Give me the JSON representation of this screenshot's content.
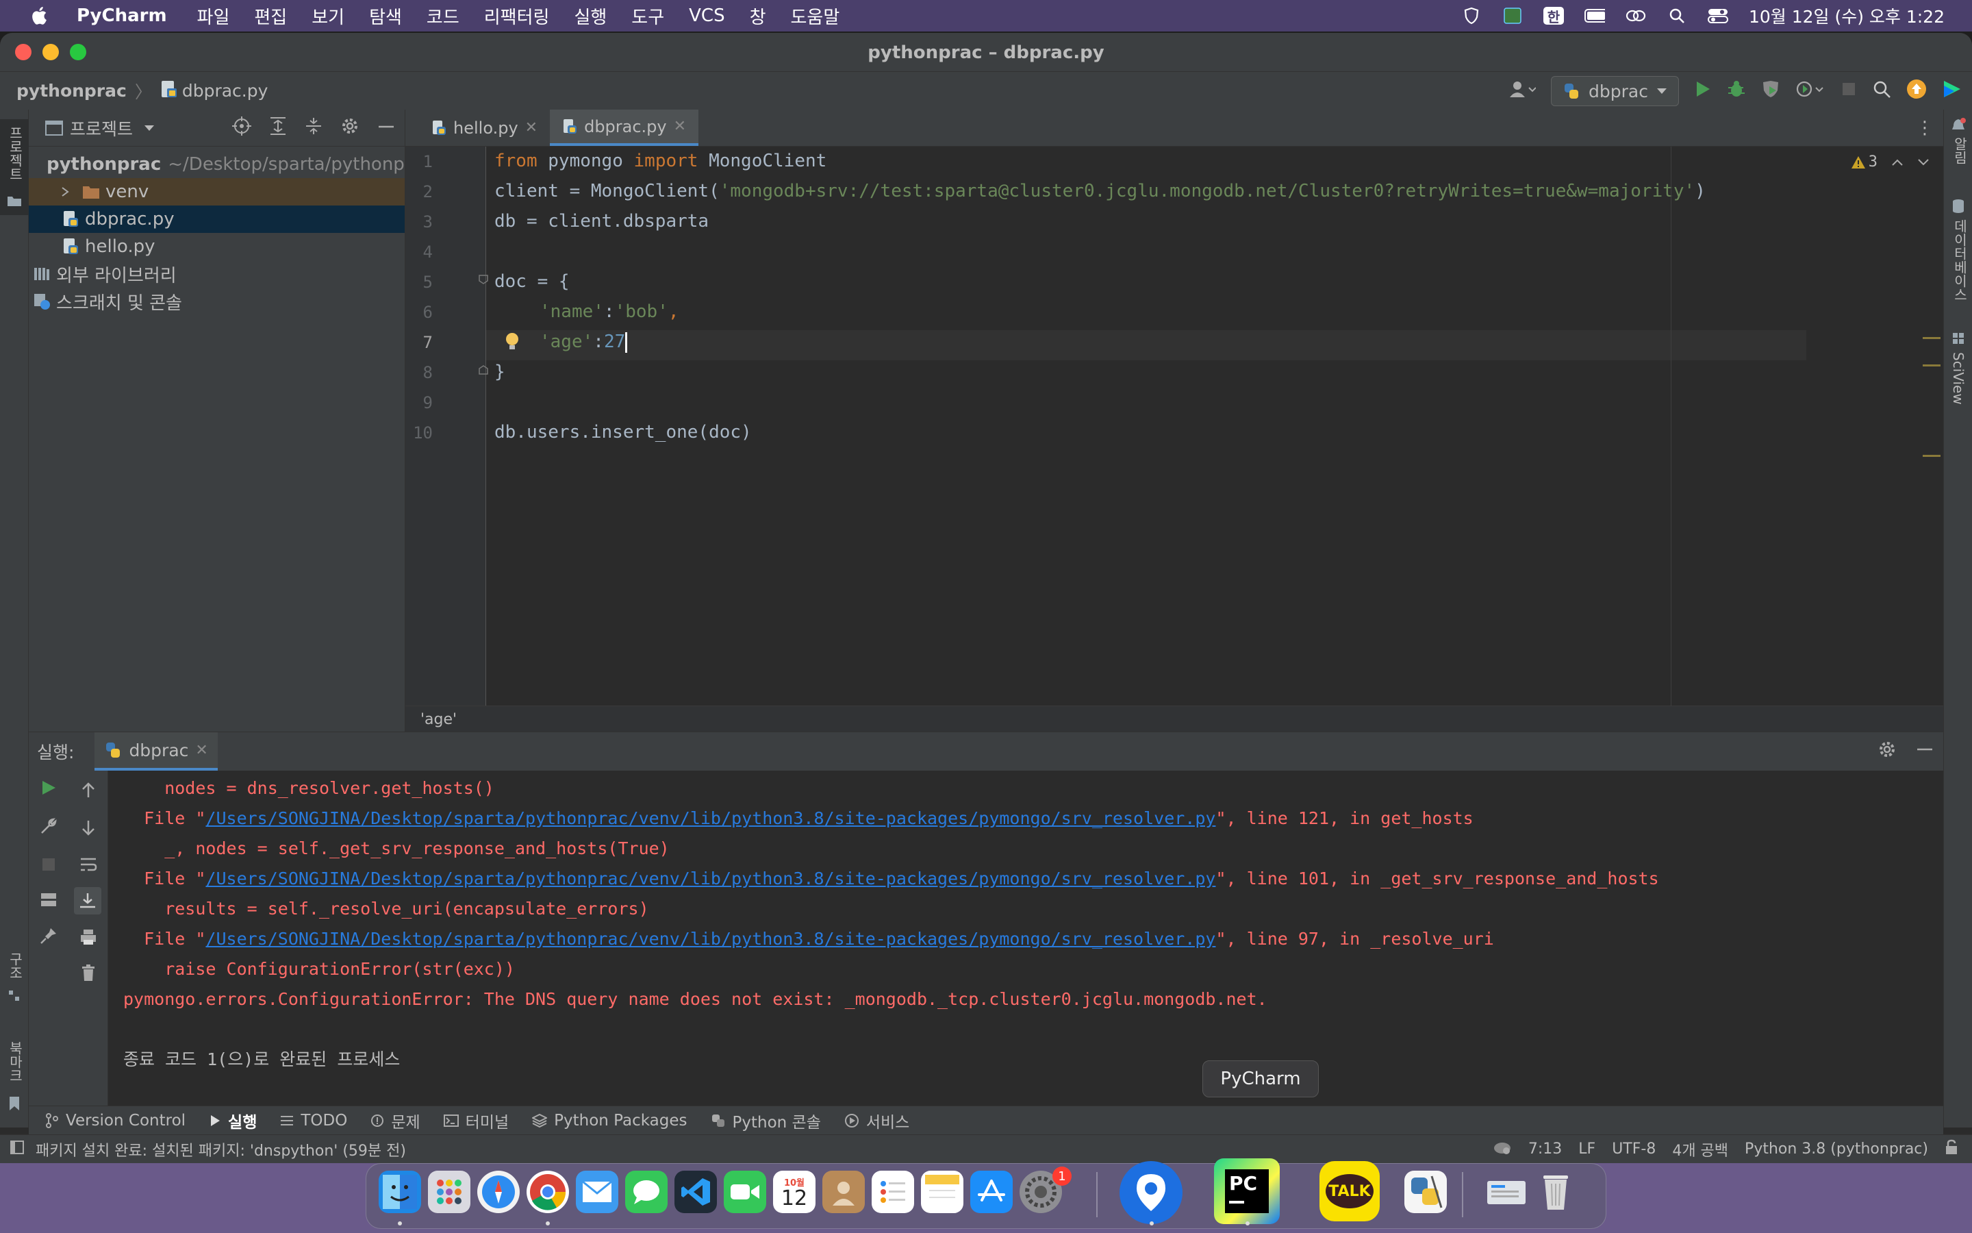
{
  "menubar": {
    "app_name": "PyCharm",
    "items": [
      "파일",
      "편집",
      "보기",
      "탐색",
      "코드",
      "리팩터링",
      "실행",
      "도구",
      "VCS",
      "창",
      "도움말"
    ],
    "input_source": "한",
    "clock": "10월 12일 (수) 오후 1:22"
  },
  "window": {
    "title": "pythonprac – dbprac.py"
  },
  "navbar": {
    "project": "pythonprac",
    "file": "dbprac.py",
    "run_config": "dbprac"
  },
  "left_strip": {
    "project_label": "프로젝트",
    "structure_label": "구조",
    "bookmarks_label": "북마크"
  },
  "right_strip": {
    "notifications_label": "알림",
    "database_label": "데이터베이스",
    "sciview_label": "SciView"
  },
  "project_panel": {
    "header": "프로젝트",
    "root_name": "pythonprac",
    "root_path": "~/Desktop/sparta/pythonprac",
    "items": [
      "venv",
      "dbprac.py",
      "hello.py",
      "외부 라이브러리",
      "스크래치 및 콘솔"
    ]
  },
  "tabs": [
    {
      "label": "hello.py"
    },
    {
      "label": "dbprac.py"
    }
  ],
  "editor": {
    "warnings_count": "3",
    "line_numbers": [
      "1",
      "2",
      "3",
      "4",
      "5",
      "6",
      "7",
      "8",
      "9",
      "10"
    ],
    "line1": {
      "kw1": "from",
      "mid": " pymongo ",
      "kw2": "import",
      "rest": " MongoClient"
    },
    "line2": {
      "pre": "client = MongoClient(",
      "str": "'mongodb+srv://test:sparta@cluster0.jcglu.mongodb.net/Cluster0?retryWrites=true&w=majority'",
      "post": ")"
    },
    "line3": "db = client.dbsparta",
    "line5": "doc = {",
    "line6": {
      "k": "'name'",
      "sep": ":",
      "v": "'bob'",
      "end": ","
    },
    "line7": {
      "k": "'age'",
      "sep": ":",
      "v": "27"
    },
    "line8": "}",
    "line10": "db.users.insert_one(doc)",
    "breadcrumb": "'age'"
  },
  "run_panel": {
    "label": "실행:",
    "tab": "dbprac",
    "lines": {
      "l1": "    nodes = dns_resolver.get_hosts()",
      "l2_pre": "  File \"",
      "l2_link": "/Users/SONGJINA/Desktop/sparta/pythonprac/venv/lib/python3.8/site-packages/pymongo/srv_resolver.py",
      "l2_post": "\", line 121, in get_hosts",
      "l3": "    _, nodes = self._get_srv_response_and_hosts(True)",
      "l4_pre": "  File \"",
      "l4_link": "/Users/SONGJINA/Desktop/sparta/pythonprac/venv/lib/python3.8/site-packages/pymongo/srv_resolver.py",
      "l4_post": "\", line 101, in _get_srv_response_and_hosts",
      "l5": "    results = self._resolve_uri(encapsulate_errors)",
      "l6_pre": "  File \"",
      "l6_link": "/Users/SONGJINA/Desktop/sparta/pythonprac/venv/lib/python3.8/site-packages/pymongo/srv_resolver.py",
      "l6_post": "\", line 97, in _resolve_uri",
      "l7": "    raise ConfigurationError(str(exc))",
      "l8": "pymongo.errors.ConfigurationError: The DNS query name does not exist: _mongodb._tcp.cluster0.jcglu.mongodb.net.",
      "l10": "종료 코드 1(으)로 완료된 프로세스"
    }
  },
  "tool_windows": [
    "Version Control",
    "실행",
    "TODO",
    "문제",
    "터미널",
    "Python Packages",
    "Python 콘솔",
    "서비스"
  ],
  "status": {
    "message": "패키지 설치 완료: 설치된 패키지: 'dnspython' (59분 전)",
    "position": "7:13",
    "line_sep": "LF",
    "encoding": "UTF-8",
    "indent": "4개 공백",
    "interpreter": "Python 3.8 (pythonprac)"
  },
  "tooltip": "PyCharm",
  "dock": {
    "calendar_month": "10월",
    "calendar_day": "12",
    "settings_badge": "1",
    "pycharm_label": "PC",
    "kakao_label": "TALK"
  },
  "colors": {
    "menubar": "#4a3f6b",
    "keyword": "#cc7832",
    "string": "#6a8759",
    "number": "#6897bb",
    "error": "#ff6b68",
    "link": "#287bde",
    "accent": "#4a88c7"
  }
}
